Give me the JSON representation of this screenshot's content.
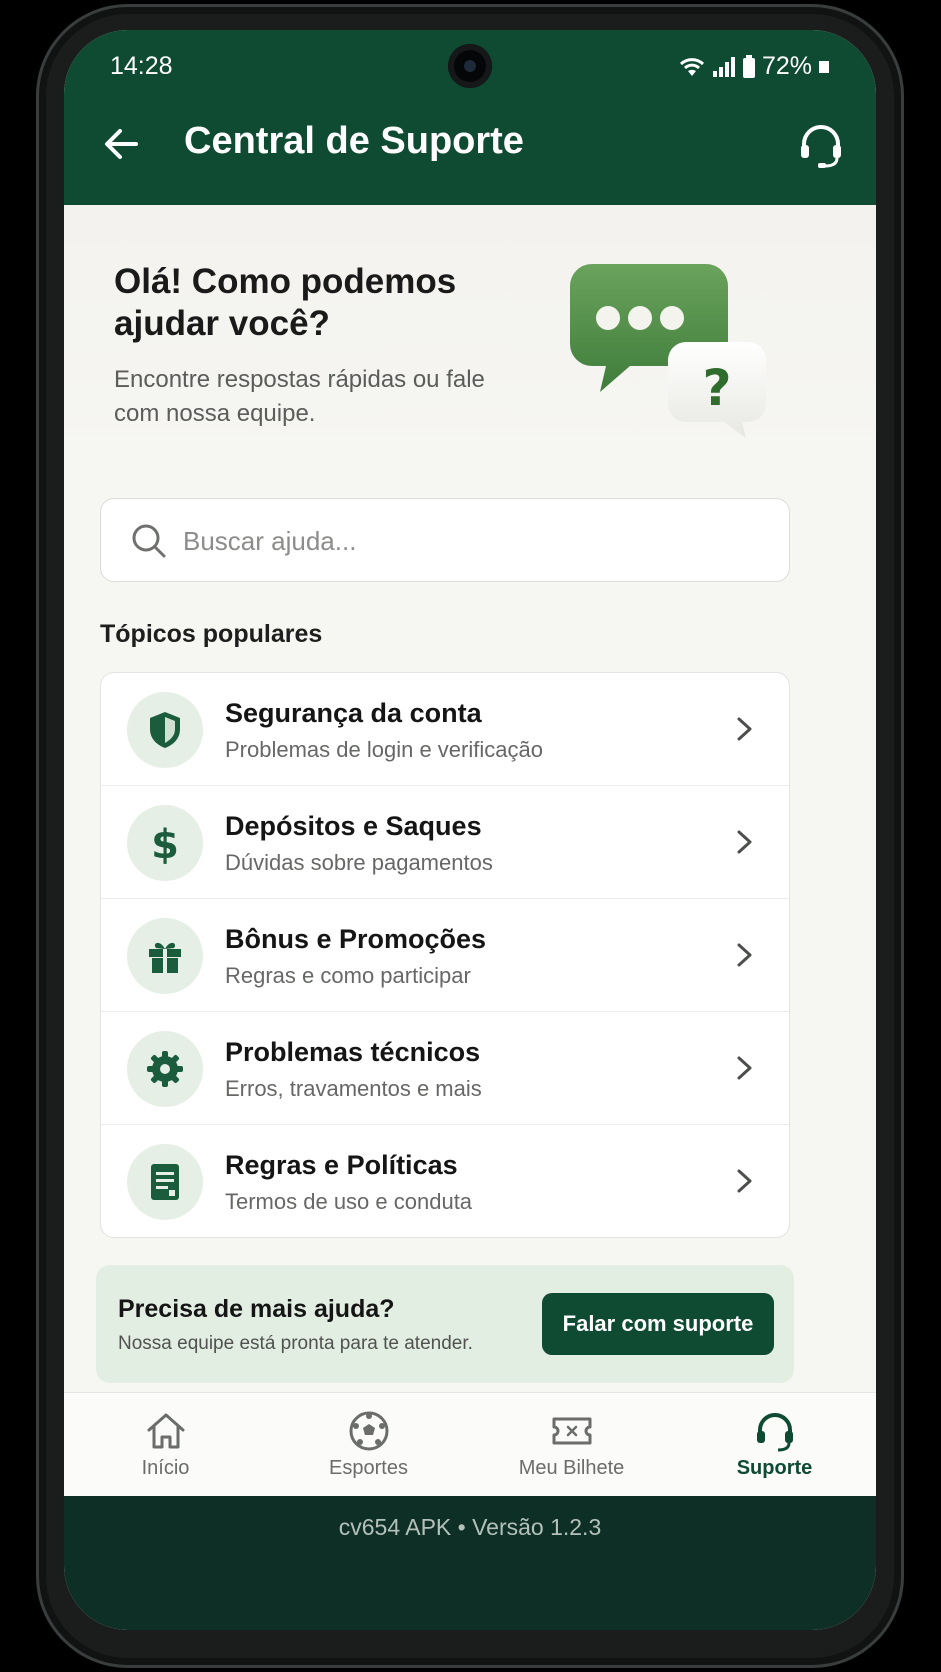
{
  "status_bar": {
    "time": "14:28",
    "battery": "72%"
  },
  "header": {
    "title": "Central de Suporte"
  },
  "hero": {
    "title": "Olá! Como podemos ajudar você?",
    "subtitle": "Encontre respostas rápidas ou fale com nossa equipe."
  },
  "search": {
    "placeholder": "Buscar ajuda...",
    "value": ""
  },
  "topics_section": {
    "title": "Tópicos populares",
    "items": [
      {
        "title": "Segurança da conta",
        "subtitle": "Problemas de login e verificação",
        "icon": "shield-icon"
      },
      {
        "title": "Depósitos e Saques",
        "subtitle": "Dúvidas sobre pagamentos",
        "icon": "dollar-icon"
      },
      {
        "title": "Bônus e Promoções",
        "subtitle": "Regras e como participar",
        "icon": "gift-icon"
      },
      {
        "title": "Problemas técnicos",
        "subtitle": "Erros, travamentos e mais",
        "icon": "gear-icon"
      },
      {
        "title": "Regras e Políticas",
        "subtitle": "Termos de uso e conduta",
        "icon": "document-icon"
      }
    ]
  },
  "help_card": {
    "title": "Precisa de mais ajuda?",
    "subtitle": "Nossa equipe está pronta para te atender.",
    "button_label": "Falar com suporte"
  },
  "bottom_nav": {
    "items": [
      {
        "label": "Início",
        "icon": "home-icon"
      },
      {
        "label": "Esportes",
        "icon": "soccer-ball-icon"
      },
      {
        "label": "Meu Bilhete",
        "icon": "ticket-icon"
      },
      {
        "label": "Suporte",
        "icon": "headset-icon"
      }
    ],
    "active": "Suporte"
  },
  "footer": {
    "text": "cv654 APK • Versão 1.2.3"
  },
  "colors": {
    "primary": "#0f4a33",
    "accent_light": "#e3eee3",
    "background": "#f6f6f3"
  }
}
